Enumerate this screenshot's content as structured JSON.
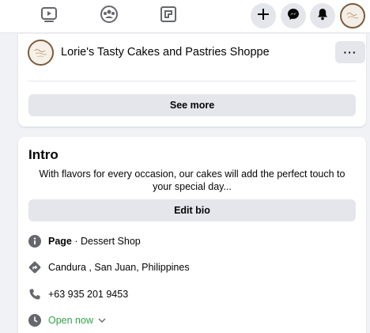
{
  "topnav": {
    "tabs": [
      {
        "icon": "watch-icon"
      },
      {
        "icon": "groups-icon"
      },
      {
        "icon": "gaming-icon"
      }
    ],
    "actions": [
      {
        "icon": "plus-icon"
      },
      {
        "icon": "messenger-icon"
      },
      {
        "icon": "bell-icon"
      }
    ]
  },
  "page_header": {
    "name": "Lorie's Tasty Cakes and Pastries Shoppe",
    "more_label": "···"
  },
  "previous_card": {
    "see_more_label": "See more"
  },
  "intro": {
    "title": "Intro",
    "bio": "With flavors for every occasion, our cakes will add the perfect touch to your special day...",
    "edit_bio_label": "Edit bio",
    "page_label": "Page",
    "page_category": " · Dessert Shop",
    "location": "Candura , San Juan, Philippines",
    "phone": "+63 935 201 9453",
    "hours_status": "Open now"
  },
  "colors": {
    "icon_gray": "#65676b",
    "button_bg": "#e4e6eb",
    "open_green": "#31a24c",
    "background": "#f0f2f5"
  }
}
